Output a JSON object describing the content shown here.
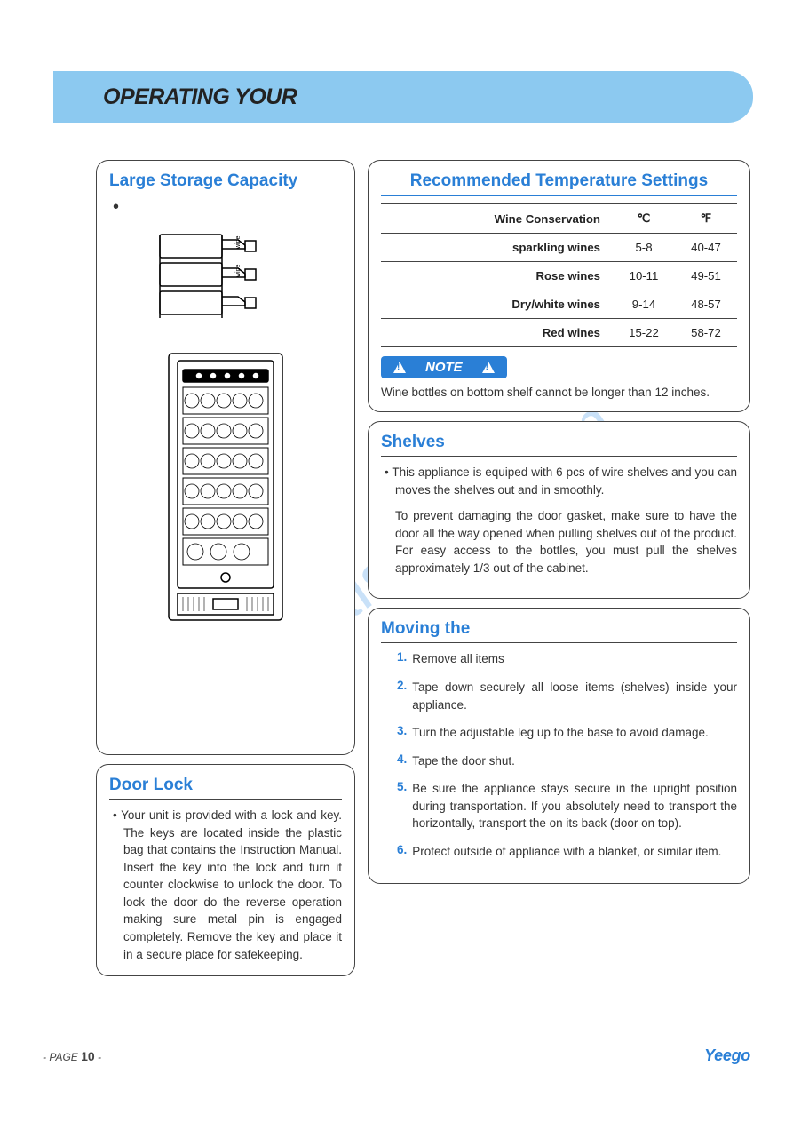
{
  "header": {
    "title": "OPERATING YOUR"
  },
  "capacity": {
    "title": "Large Storage Capacity"
  },
  "doorlock": {
    "title": "Door Lock",
    "text": "Your unit is provided with a lock and key. The keys are located inside the plastic bag that contains the Instruction Manual. Insert the key into the lock and turn it counter clockwise to unlock the door. To lock the door do the reverse operation making sure metal pin is engaged completely. Remove the key and place it in a secure place for safekeeping."
  },
  "temperature": {
    "title": "Recommended Temperature Settings",
    "headers": {
      "wine": "Wine Conservation",
      "c": "℃",
      "f": "℉"
    },
    "rows": [
      {
        "wine": "sparkling wines",
        "c": "5-8",
        "f": "40-47"
      },
      {
        "wine": "Rose wines",
        "c": "10-11",
        "f": "49-51"
      },
      {
        "wine": "Dry/white wines",
        "c": "9-14",
        "f": "48-57"
      },
      {
        "wine": "Red wines",
        "c": "15-22",
        "f": "58-72"
      }
    ],
    "note_label": "NOTE",
    "note_text": "Wine bottles on bottom shelf cannot be longer than 12 inches."
  },
  "shelves": {
    "title": "Shelves",
    "p1": "This appliance is equiped with 6 pcs of wire shelves and you can moves the shelves out and in smoothly.",
    "p2": "To prevent damaging the door gasket, make sure to have the door all the way opened when pulling shelves out of the product. For easy access to the bottles, you must pull the shelves approximately 1/3 out of the cabinet."
  },
  "moving": {
    "title": "Moving the",
    "items": [
      {
        "n": "1.",
        "t": "Remove all items"
      },
      {
        "n": "2.",
        "t": "Tape down securely all loose items (shelves) inside your appliance."
      },
      {
        "n": "3.",
        "t": "Turn the adjustable leg up to the base to avoid damage."
      },
      {
        "n": "4.",
        "t": "Tape the door shut."
      },
      {
        "n": "5.",
        "t": "Be sure the appliance stays secure in the upright position during transportation. If you absolutely need to transport the horizontally, transport the         on its back (door on top)."
      },
      {
        "n": "6.",
        "t": "Protect outside of appliance with a blanket, or similar item."
      }
    ]
  },
  "footer": {
    "page_prefix": "- PAGE ",
    "page_num": "10",
    "page_suffix": " -",
    "brand": "Yeego"
  },
  "watermark": "manualshive.com"
}
